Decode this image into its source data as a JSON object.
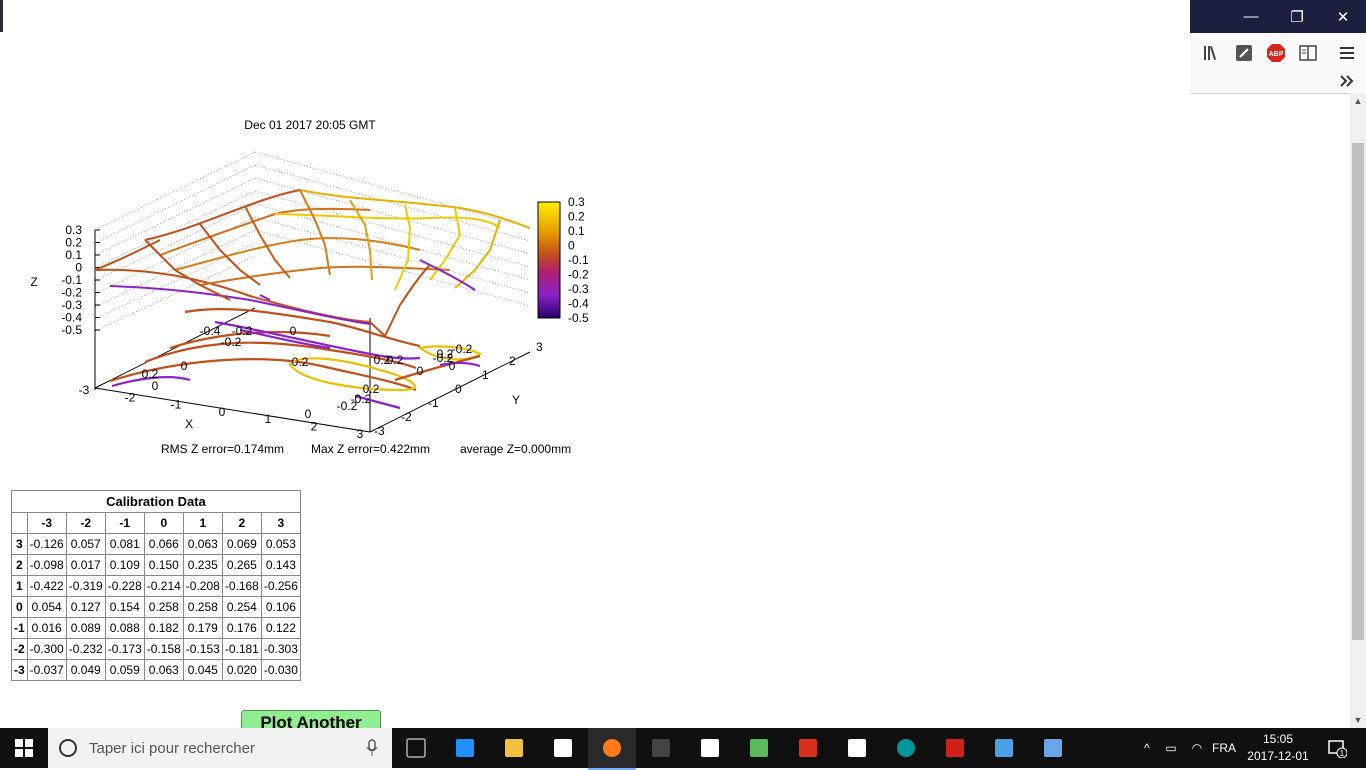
{
  "window": {
    "minimize_glyph": "—",
    "restore_glyph": "❐",
    "close_glyph": "✕"
  },
  "toolbar": {
    "icons": [
      "library-icon",
      "stylus-icon",
      "adblock-plus-icon",
      "reader-view-icon",
      "menu-icon",
      "overflow-chevron-icon"
    ],
    "abp_label": "ABP"
  },
  "plot": {
    "title": "Dec 01 2017 20:05 GMT",
    "z_label": "Z",
    "x_label": "X",
    "y_label": "Y",
    "z_ticks": [
      "0.3",
      "0.2",
      "0.1",
      "0",
      "-0.1",
      "-0.2",
      "-0.3",
      "-0.4",
      "-0.5"
    ],
    "x_ticks": [
      "-3",
      "-2",
      "-1",
      "0",
      "1",
      "2",
      "3"
    ],
    "y_ticks": [
      "-3",
      "-2",
      "-1",
      "0",
      "1",
      "2",
      "3"
    ],
    "colorbar_ticks": [
      "0.3",
      "0.2",
      "0.1",
      "0",
      "-0.1",
      "-0.2",
      "-0.3",
      "-0.4",
      "-0.5"
    ],
    "contour_labels": [
      "-0.4",
      "-0.2",
      "-0.2",
      "0",
      "0",
      "0.2",
      "0",
      "0.2",
      "0.2",
      "-0.2",
      "0",
      "0.2",
      "0.2",
      "0",
      "-0.2",
      "0",
      "-0.2",
      "-0.2",
      "0.2"
    ],
    "rms_text": "RMS Z error=0.174mm",
    "max_text": "Max Z error=0.422mm",
    "avg_text": "average Z=0.000mm",
    "colors": {
      "high": "#ffee00",
      "mid": "#c0501a",
      "low": "#8a22c8",
      "bottom": "#2a006a"
    }
  },
  "table": {
    "caption": "Calibration Data",
    "columns": [
      "-3",
      "-2",
      "-1",
      "0",
      "1",
      "2",
      "3"
    ],
    "rows": [
      {
        "label": "3",
        "values": [
          "-0.126",
          "0.057",
          "0.081",
          "0.066",
          "0.063",
          "0.069",
          "0.053"
        ]
      },
      {
        "label": "2",
        "values": [
          "-0.098",
          "0.017",
          "0.109",
          "0.150",
          "0.235",
          "0.265",
          "0.143"
        ]
      },
      {
        "label": "1",
        "values": [
          "-0.422",
          "-0.319",
          "-0.228",
          "-0.214",
          "-0.208",
          "-0.168",
          "-0.256"
        ]
      },
      {
        "label": "0",
        "values": [
          "0.054",
          "0.127",
          "0.154",
          "0.258",
          "0.258",
          "0.254",
          "0.106"
        ]
      },
      {
        "label": "-1",
        "values": [
          "0.016",
          "0.089",
          "0.088",
          "0.182",
          "0.179",
          "0.176",
          "0.122"
        ]
      },
      {
        "label": "-2",
        "values": [
          "-0.300",
          "-0.232",
          "-0.173",
          "-0.158",
          "-0.153",
          "-0.181",
          "-0.303"
        ]
      },
      {
        "label": "-3",
        "values": [
          "-0.037",
          "0.049",
          "0.059",
          "0.063",
          "0.045",
          "0.020",
          "-0.030"
        ]
      }
    ]
  },
  "button": {
    "label": "Plot Another"
  },
  "taskbar": {
    "search_placeholder": "Taper ici pour rechercher",
    "apps": [
      "task-view-icon",
      "edge-icon",
      "file-explorer-icon",
      "store-icon",
      "firefox-icon",
      "terminal-icon",
      "file-icon",
      "app-icon",
      "filezilla-icon",
      "mail-icon",
      "arduino-icon",
      "acrobat-icon",
      "control-panel-icon",
      "network-app-icon"
    ],
    "language": "FRA",
    "time": "15:05",
    "date": "2017-12-01",
    "notification_count": "1"
  }
}
